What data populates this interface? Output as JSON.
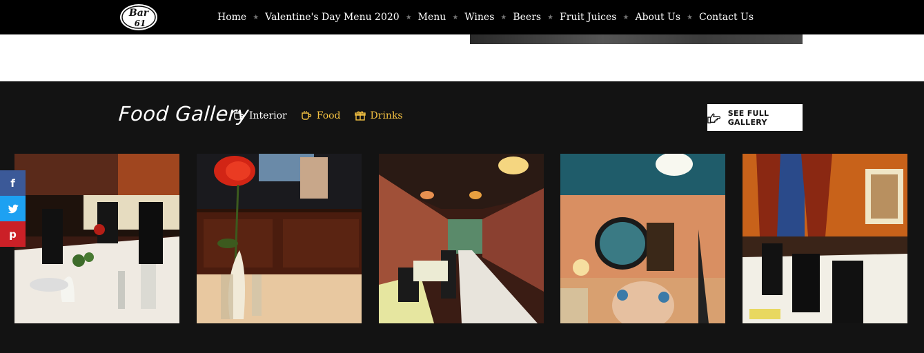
{
  "header": {
    "logo_text": "Bar 61",
    "nav": [
      {
        "label": "Home"
      },
      {
        "label": "Valentine's Day Menu 2020"
      },
      {
        "label": "Menu"
      },
      {
        "label": "Wines"
      },
      {
        "label": "Beers"
      },
      {
        "label": "Fruit Juices"
      },
      {
        "label": "About Us"
      },
      {
        "label": "Contact Us"
      }
    ],
    "separator": "★"
  },
  "gallery": {
    "title": "Food Gallery",
    "filters": [
      {
        "label": "Interior",
        "icon": "cup-icon",
        "active": false
      },
      {
        "label": "Food",
        "icon": "mug-icon",
        "active": true
      },
      {
        "label": "Drinks",
        "icon": "gift-icon",
        "active": true
      }
    ],
    "full_gallery_label": "SEE FULL GALLERY",
    "full_gallery_icon": "pointing-hand-icon",
    "tiles": [
      {
        "scene": "restaurant-table-flowers"
      },
      {
        "scene": "red-rose-bar"
      },
      {
        "scene": "long-dining-hall"
      },
      {
        "scene": "wall-decor-mirror"
      },
      {
        "scene": "orange-room-tables"
      }
    ]
  },
  "social": [
    {
      "icon": "facebook-icon",
      "glyph": "f"
    },
    {
      "icon": "twitter-icon",
      "glyph": "t"
    },
    {
      "icon": "pinterest-icon",
      "glyph": "p"
    }
  ],
  "colors": {
    "header_bg": "#000000",
    "gallery_bg": "#131313",
    "accent": "#f5c242",
    "facebook": "#3b5998",
    "twitter": "#1da1f2",
    "pinterest": "#cb2027"
  }
}
